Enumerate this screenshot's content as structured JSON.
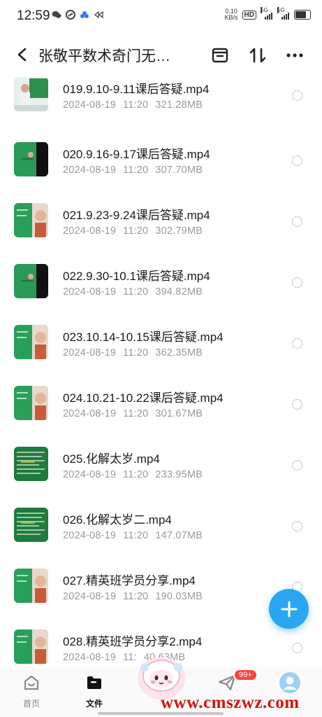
{
  "status": {
    "time": "12:59",
    "net_speed_value": "0.10",
    "net_speed_unit": "KB/s",
    "hd": "HD",
    "sig1": "5G",
    "sig2": "5G"
  },
  "header": {
    "title": "张敬平数术奇门无…"
  },
  "files": [
    {
      "name": "019.9.10-9.11课后答疑.mp4",
      "date": "2024-08-19",
      "time": "11:20",
      "size": "321.28MB",
      "thumb": "teacher"
    },
    {
      "name": "020.9.16-9.17课后答疑.mp4",
      "date": "2024-08-19",
      "time": "11:20",
      "size": "307.70MB",
      "thumb": "green-dark"
    },
    {
      "name": "021.9.23-9.24课后答疑.mp4",
      "date": "2024-08-19",
      "time": "11:20",
      "size": "302.79MB",
      "thumb": "green-face"
    },
    {
      "name": "022.9.30-10.1课后答疑.mp4",
      "date": "2024-08-19",
      "time": "11:20",
      "size": "394.82MB",
      "thumb": "green-dark"
    },
    {
      "name": "023.10.14-10.15课后答疑.mp4",
      "date": "2024-08-19",
      "time": "11:20",
      "size": "362.35MB",
      "thumb": "green-face"
    },
    {
      "name": "024.10.21-10.22课后答疑.mp4",
      "date": "2024-08-19",
      "time": "11:20",
      "size": "301.67MB",
      "thumb": "green-face"
    },
    {
      "name": "025.化解太岁.mp4",
      "date": "2024-08-19",
      "time": "11:20",
      "size": "233.95MB",
      "thumb": "board"
    },
    {
      "name": "026.化解太岁二.mp4",
      "date": "2024-08-19",
      "time": "11:20",
      "size": "147.07MB",
      "thumb": "board"
    },
    {
      "name": "027.精英班学员分享.mp4",
      "date": "2024-08-19",
      "time": "11:20",
      "size": "190.03MB",
      "thumb": "green-face"
    },
    {
      "name": "028.精英班学员分享2.mp4",
      "date": "2024-08-19",
      "time": "11:",
      "size": "40.63MB",
      "thumb": "green-face"
    }
  ],
  "tabs": {
    "home": "首页",
    "files": "文件",
    "badge": "99+"
  },
  "watermark": "www.cmszwz.com",
  "colors": {
    "accent": "#2aa6f3",
    "badge": "#f5453f",
    "watermark": "#d8130b"
  }
}
